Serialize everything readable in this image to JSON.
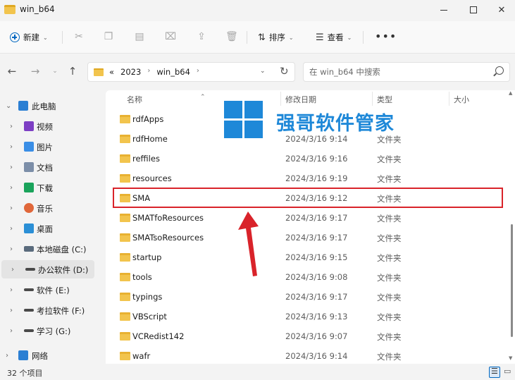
{
  "window": {
    "title": "win_b64",
    "minimize": "—",
    "close": "✕"
  },
  "toolbar": {
    "new_label": "新建",
    "sort_label": "排序",
    "view_label": "查看",
    "more": "•••"
  },
  "address": {
    "overflow": "«",
    "crumbs": [
      "2023",
      "win_b64"
    ],
    "chevron": "›"
  },
  "search": {
    "placeholder": "在 win_b64 中搜索"
  },
  "sidebar": {
    "items": [
      {
        "label": "此电脑",
        "icon": "computer-icon",
        "color": "#2b7fd3"
      },
      {
        "label": "视频",
        "icon": "video-icon",
        "color": "#7d3fc4"
      },
      {
        "label": "图片",
        "icon": "pictures-icon",
        "color": "#3a8ee6"
      },
      {
        "label": "文档",
        "icon": "documents-icon",
        "color": "#7c8ea8"
      },
      {
        "label": "下载",
        "icon": "download-icon",
        "color": "#1aa35b"
      },
      {
        "label": "音乐",
        "icon": "music-icon",
        "color": "#e0673a"
      },
      {
        "label": "桌面",
        "icon": "desktop-icon",
        "color": "#2b8fd6"
      },
      {
        "label": "本地磁盘 (C:)",
        "icon": "drive-c-icon",
        "color": "#5a6b7d"
      },
      {
        "label": "办公软件 (D:)",
        "icon": "drive-icon",
        "color": "#4a4a4a"
      },
      {
        "label": "软件 (E:)",
        "icon": "drive-icon",
        "color": "#4a4a4a"
      },
      {
        "label": "考拉软件 (F:)",
        "icon": "drive-icon",
        "color": "#4a4a4a"
      },
      {
        "label": "学习 (G:)",
        "icon": "drive-icon",
        "color": "#4a4a4a"
      },
      {
        "label": "网络",
        "icon": "network-icon",
        "color": "#2b7fd3"
      }
    ]
  },
  "columns": {
    "name": "名称",
    "modified": "修改日期",
    "type": "类型",
    "size": "大小"
  },
  "files": [
    {
      "name": "rdfApps",
      "date": "",
      "type": ""
    },
    {
      "name": "rdfHome",
      "date": "2024/3/16 9:14",
      "type": "文件夹"
    },
    {
      "name": "reffiles",
      "date": "2024/3/16 9:16",
      "type": "文件夹"
    },
    {
      "name": "resources",
      "date": "2024/3/16 9:19",
      "type": "文件夹"
    },
    {
      "name": "SMA",
      "date": "2024/3/16 9:12",
      "type": "文件夹"
    },
    {
      "name": "SMATfoResources",
      "date": "2024/3/16 9:17",
      "type": "文件夹"
    },
    {
      "name": "SMATsoResources",
      "date": "2024/3/16 9:17",
      "type": "文件夹"
    },
    {
      "name": "startup",
      "date": "2024/3/16 9:15",
      "type": "文件夹"
    },
    {
      "name": "tools",
      "date": "2024/3/16 9:08",
      "type": "文件夹"
    },
    {
      "name": "typings",
      "date": "2024/3/16 9:17",
      "type": "文件夹"
    },
    {
      "name": "VBScript",
      "date": "2024/3/16 9:13",
      "type": "文件夹"
    },
    {
      "name": "VCRedist142",
      "date": "2024/3/16 9:07",
      "type": "文件夹"
    },
    {
      "name": "wafr",
      "date": "2024/3/16 9:14",
      "type": "文件夹"
    }
  ],
  "watermark": {
    "text": "强哥软件管家"
  },
  "status": {
    "count": "32 个项目"
  },
  "colors": {
    "accent": "#0067c0",
    "highlight": "#d9232a",
    "folder": "#f2c44d",
    "watermark": "#1e88d8"
  }
}
